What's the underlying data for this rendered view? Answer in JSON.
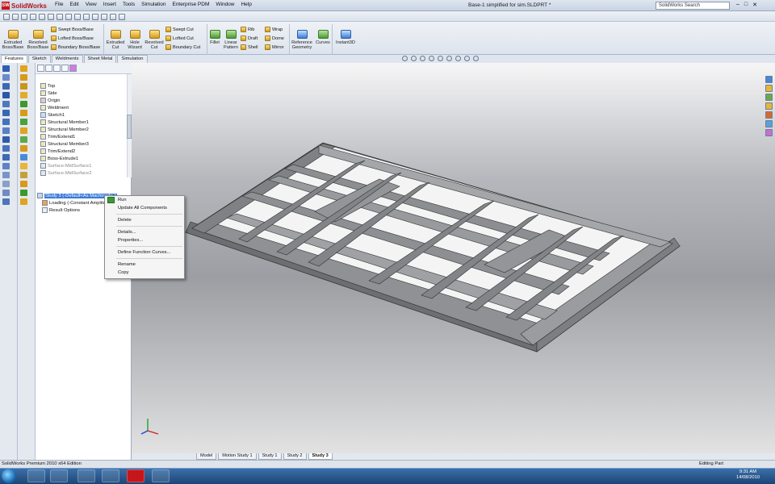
{
  "app": {
    "name": "SolidWorks",
    "doc_title": "Base-1 simplified for sim.SLDPRT *",
    "search_placeholder": "SolidWorks Search"
  },
  "menus": [
    "File",
    "Edit",
    "View",
    "Insert",
    "Tools",
    "Simulation",
    "Enterprise PDM",
    "Window",
    "Help"
  ],
  "ribbon": {
    "extruded_boss": "Extruded Boss/Base",
    "revolved_boss": "Revolved Boss/Base",
    "swept_boss": "Swept Boss/Base",
    "lofted_boss": "Lofted Boss/Base",
    "boundary_boss": "Boundary Boss/Base",
    "extruded_cut": "Extruded Cut",
    "hole_wizard": "Hole Wizard",
    "revolved_cut": "Revolved Cut",
    "swept_cut": "Swept Cut",
    "lofted_cut": "Lofted Cut",
    "boundary_cut": "Boundary Cut",
    "fillet": "Fillet",
    "linear_pattern": "Linear Pattern",
    "rib": "Rib",
    "draft": "Draft",
    "shell": "Shell",
    "wrap": "Wrap",
    "dome": "Dome",
    "mirror": "Mirror",
    "reference_geometry": "Reference Geometry",
    "curves": "Curves",
    "instant3d": "Instant3D"
  },
  "command_tabs": [
    "Features",
    "Sketch",
    "Weldments",
    "Sheet Metal",
    "Simulation"
  ],
  "tree": [
    "Top",
    "Side",
    "Origin",
    "Weldment",
    "Sketch1",
    "Structural Member1",
    "Structural Member2",
    "Trim/Extend1",
    "Structural Member3",
    "Trim/Extend2",
    "Boss-Extrude1",
    "Surface-MidSurface1",
    "Surface-MidSurface2"
  ],
  "simulation_tree": {
    "study": "Study 3 (-Default<As Machined>-)",
    "loading": "Loading (-Constant Amplitude-)",
    "result_options": "Result Options"
  },
  "context_menu": [
    "Run",
    "Update All Components",
    "Delete",
    "Details...",
    "Properties...",
    "Define Function Curves...",
    "Rename",
    "Copy"
  ],
  "bottom_tabs": [
    "Model",
    "Motion Study 1",
    "Study 1",
    "Study 2",
    "Study 3"
  ],
  "status": {
    "left": "SolidWorks Premium 2010 x64 Edition",
    "right": "Editing Part"
  },
  "clock": {
    "time": "9:31 AM",
    "date": "14/08/2010"
  }
}
